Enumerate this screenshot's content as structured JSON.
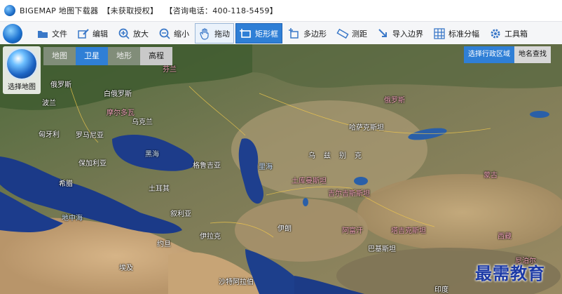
{
  "titlebar": {
    "app_name": "BIGEMAP 地图下载器",
    "license": "【未获取授权】",
    "phone": "【咨询电话：400-118-5459】"
  },
  "toolbar": {
    "items": [
      {
        "label": "文件",
        "icon": "folder-icon"
      },
      {
        "label": "编辑",
        "icon": "edit-icon"
      },
      {
        "label": "放大",
        "icon": "zoom-in-icon"
      },
      {
        "label": "缩小",
        "icon": "zoom-out-icon"
      },
      {
        "label": "拖动",
        "icon": "hand-icon"
      },
      {
        "label": "矩形框",
        "icon": "rectangle-select-icon"
      },
      {
        "label": "多边形",
        "icon": "polygon-icon"
      },
      {
        "label": "测距",
        "icon": "ruler-icon"
      },
      {
        "label": "导入边界",
        "icon": "import-icon"
      },
      {
        "label": "标准分幅",
        "icon": "grid-icon"
      },
      {
        "label": "工具箱",
        "icon": "gear-icon"
      }
    ]
  },
  "map_select": {
    "label": "选择地图"
  },
  "map_types": [
    "地图",
    "卫星",
    "地形",
    "高程"
  ],
  "map_type_selected": "卫星",
  "region_tabs": [
    "选择行政区域",
    "地名查找"
  ],
  "map_labels": [
    {
      "text": "芬兰",
      "style": "p"
    },
    {
      "text": "俄罗斯",
      "style": "w"
    },
    {
      "text": "白俄罗斯",
      "style": "w"
    },
    {
      "text": "波兰",
      "style": "w"
    },
    {
      "text": "乌克兰",
      "style": "w"
    },
    {
      "text": "摩尔多瓦",
      "style": "p"
    },
    {
      "text": "匈牙利",
      "style": "w"
    },
    {
      "text": "罗马尼亚",
      "style": "w"
    },
    {
      "text": "保加利亚",
      "style": "w"
    },
    {
      "text": "黑海",
      "style": "b"
    },
    {
      "text": "格鲁吉亚",
      "style": "w"
    },
    {
      "text": "希腊",
      "style": "w"
    },
    {
      "text": "土耳其",
      "style": "w"
    },
    {
      "text": "叙利亚",
      "style": "w"
    },
    {
      "text": "伊拉克",
      "style": "w"
    },
    {
      "text": "约旦",
      "style": "w"
    },
    {
      "text": "地中海",
      "style": "b"
    },
    {
      "text": "里海",
      "style": "b"
    },
    {
      "text": "伊朗",
      "style": "w"
    },
    {
      "text": "土库曼斯坦",
      "style": "p"
    },
    {
      "text": "阿富汗",
      "style": "p"
    },
    {
      "text": "巴基斯坦",
      "style": "w"
    },
    {
      "text": "哈萨克斯坦",
      "style": "w"
    },
    {
      "text": "乌兹别克",
      "style": "w"
    },
    {
      "text": "吉尔吉斯斯坦",
      "style": "p"
    },
    {
      "text": "塔吉克斯坦",
      "style": "p"
    },
    {
      "text": "俄罗斯",
      "style": "p"
    },
    {
      "text": "蒙古",
      "style": "p"
    },
    {
      "text": "印度",
      "style": "w"
    },
    {
      "text": "西藏",
      "style": "p"
    },
    {
      "text": "尼泊尔",
      "style": "p"
    },
    {
      "text": "沙特阿拉伯",
      "style": "w"
    },
    {
      "text": "埃及",
      "style": "w"
    }
  ],
  "watermark": "最需教育",
  "colors": {
    "accent": "#2f7fd6",
    "toolbar_bg": "#f5f6f8",
    "watermark": "#1c3aa6"
  }
}
